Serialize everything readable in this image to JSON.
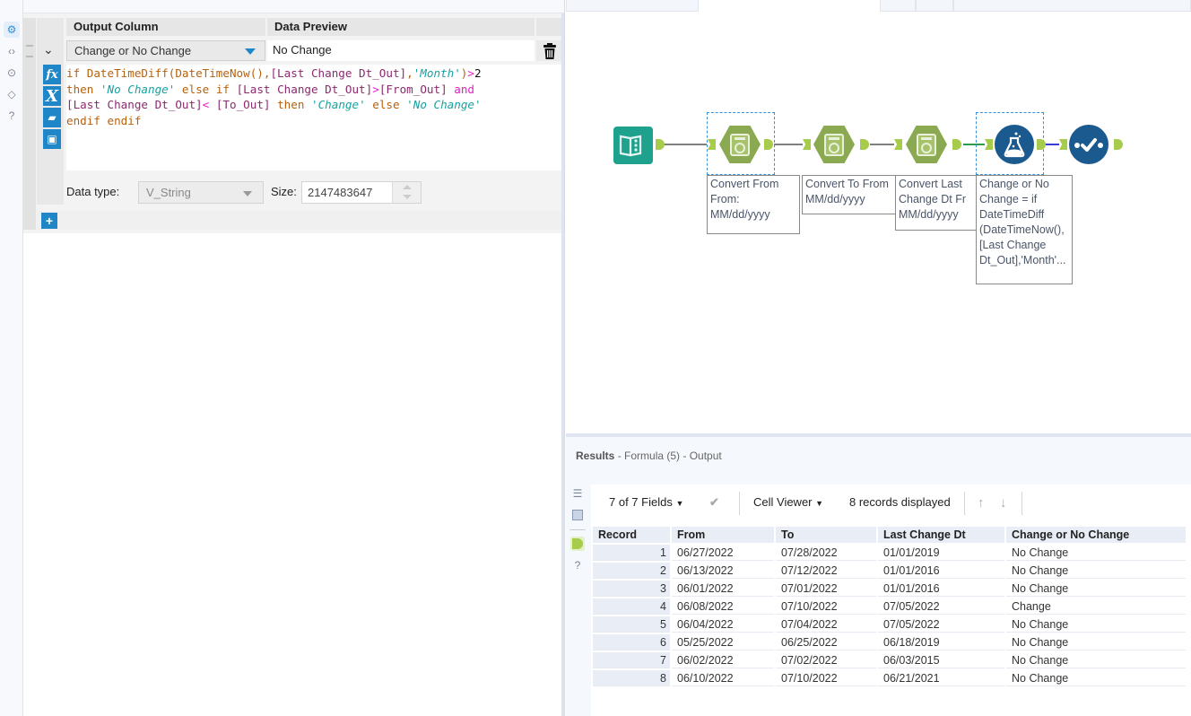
{
  "config_panel": {
    "rail_icons": [
      "gear-icon",
      "code-icon",
      "anchor-icon",
      "tag-icon",
      "help-icon"
    ],
    "grid": {
      "headers": {
        "output_column": "Output Column",
        "data_preview": "Data Preview"
      },
      "row": {
        "output_column_value": "Change or No Change",
        "data_preview_value": "No Change"
      },
      "formula_lines": [
        "if DateTimeDiff(DateTimeNow(),[Last Change Dt_Out],'Month')>2",
        "then 'No Change' else if [Last Change Dt_Out]>[From_Out] and",
        "[Last Change Dt_Out]< [To_Out] then 'Change' else 'No Change'",
        "endif endif"
      ],
      "editor_tools": [
        "functions-icon",
        "variables-icon",
        "open-expression-icon",
        "save-expression-icon"
      ],
      "data_type_label": "Data type:",
      "data_type_value": "V_String",
      "size_label": "Size:",
      "size_value": "2147483647",
      "add_label": "+"
    }
  },
  "canvas": {
    "tools": [
      {
        "name": "input-data-tool",
        "annotation": ""
      },
      {
        "name": "datetime-tool-1",
        "annotation": "Convert From\nFrom:\nMM/dd/yyyy"
      },
      {
        "name": "datetime-tool-2",
        "annotation": "Convert To From\nMM/dd/yyyy"
      },
      {
        "name": "datetime-tool-3",
        "annotation": "Convert Last\nChange Dt Fr\nMM/dd/yyyy"
      },
      {
        "name": "formula-tool",
        "annotation": "Change or No\nChange = if\nDateTimeDiff\n(DateTimeNow(),\n[Last Change\nDt_Out],'Month'..."
      },
      {
        "name": "browse-tool",
        "annotation": ""
      }
    ],
    "colors": {
      "datetime": "#8aa951",
      "anchor": "#a7cb4a",
      "formula": "#1b5a8e",
      "input": "#1ea18d"
    }
  },
  "results": {
    "title_bold": "Results",
    "title_rest": " - Formula (5) - Output",
    "fields_label": "7 of 7 Fields",
    "cell_viewer_label": "Cell Viewer",
    "records_label": "8 records displayed",
    "columns": [
      "Record",
      "From",
      "To",
      "Last Change Dt",
      "Change or No Change"
    ],
    "rows": [
      [
        "1",
        "06/27/2022",
        "07/28/2022",
        "01/01/2019",
        "No Change"
      ],
      [
        "2",
        "06/13/2022",
        "07/12/2022",
        "01/01/2016",
        "No Change"
      ],
      [
        "3",
        "06/01/2022",
        "07/01/2022",
        "01/01/2016",
        "No Change"
      ],
      [
        "4",
        "06/08/2022",
        "07/10/2022",
        "07/05/2022",
        "Change"
      ],
      [
        "5",
        "06/04/2022",
        "07/04/2022",
        "07/05/2022",
        "No Change"
      ],
      [
        "6",
        "05/25/2022",
        "06/25/2022",
        "06/18/2019",
        "No Change"
      ],
      [
        "7",
        "06/02/2022",
        "07/02/2022",
        "06/03/2015",
        "No Change"
      ],
      [
        "8",
        "06/10/2022",
        "07/10/2022",
        "06/21/2021",
        "No Change"
      ]
    ]
  }
}
